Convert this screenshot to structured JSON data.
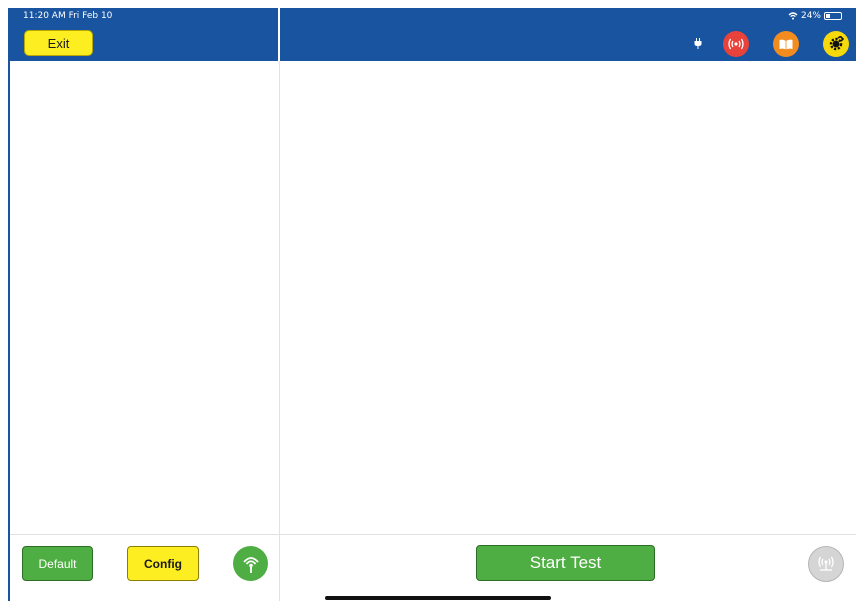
{
  "status_bar": {
    "time_date": "11:20 AM  Fri Feb 10",
    "battery": "24%",
    "icons": [
      "wifi-icon",
      "battery-icon"
    ]
  },
  "header": {
    "exit_label": "Exit",
    "icons": [
      "plug-icon",
      "signal-icon",
      "book-icon",
      "gear-icon"
    ]
  },
  "footer": {
    "default_label": "Default",
    "config_label": "Config",
    "start_test_label": "Start Test",
    "icons": [
      "antenna-icon",
      "broadcast-icon"
    ]
  },
  "colors": {
    "header_blue": "#1854a0",
    "yellow": "#fcee21",
    "green": "#4fae43",
    "red": "#e8423a",
    "orange": "#f28c1e",
    "gray": "#d5d5d5"
  }
}
